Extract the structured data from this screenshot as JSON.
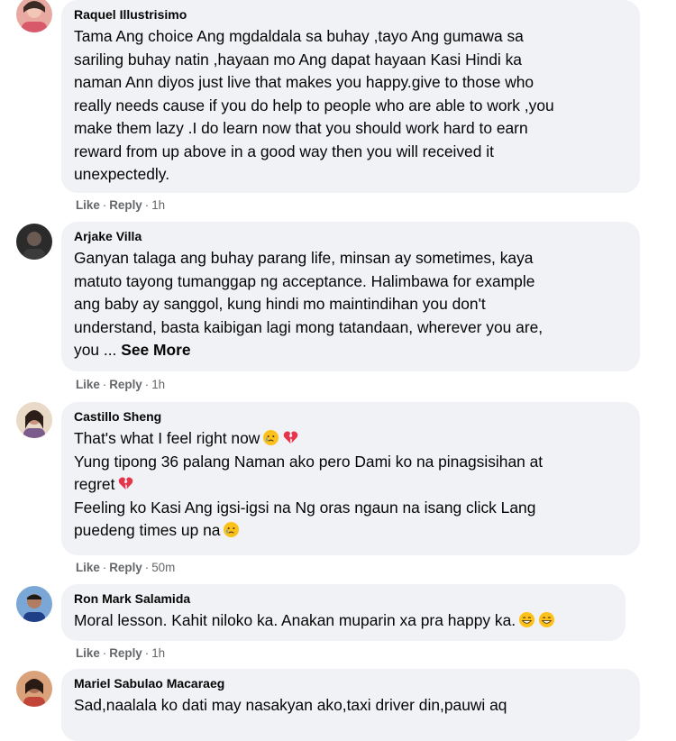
{
  "comments": [
    {
      "author": "Raquel Illustrisimo",
      "lines": [
        "Tama Ang choice Ang mgdaldala sa buhay ,tayo Ang gumawa sa",
        "sariling buhay natin ,hayaan mo Ang dapat hayaan Kasi Hindi ka",
        "naman Ann diyos just live that makes you happy.give to those who",
        "really needs cause if you do help to people who are able to work ,you",
        "make them lazy .I do learn now that you should work hard to earn",
        "reward from up above in a good way then you will received it",
        "unexpectedly."
      ],
      "like_label": "Like",
      "reply_label": "Reply",
      "separator": "·",
      "time": "1h"
    },
    {
      "author": "Arjake Villa",
      "lines": [
        "Ganyan talaga ang buhay parang life, minsan ay sometimes, kaya",
        "matuto tayong tumanggap ng acceptance. Halimbawa for example",
        "ang baby ay sanggol, kung hindi mo maintindihan you don't",
        "understand, basta kaibigan lagi mong tatandaan, wherever you are,",
        "you ..."
      ],
      "see_more": "See More",
      "like_label": "Like",
      "reply_label": "Reply",
      "separator": "·",
      "time": "1h"
    },
    {
      "author": "Castillo Sheng",
      "lines": [
        "That's what I feel right now",
        "Yung tipong 36 palang Naman ako pero Dami ko na pinagsisihan at",
        "regret",
        "Feeling ko Kasi Ang igsi-igsi na Ng oras ngaun na isang click Lang",
        "puedeng times up na"
      ],
      "like_label": "Like",
      "reply_label": "Reply",
      "separator": "·",
      "time": "50m"
    },
    {
      "author": "Ron Mark Salamida",
      "lines": [
        "Moral lesson. Kahit niloko ka. Anakan muparin xa pra happy ka."
      ],
      "like_label": "Like",
      "reply_label": "Reply",
      "separator": "·",
      "time": "1h"
    },
    {
      "author": "Mariel Sabulao Macaraeg",
      "lines": [
        "Sad,naalala ko dati may nasakyan ako,taxi driver din,pauwi aq"
      ]
    }
  ],
  "colors": {
    "bubble_bg": "#f0f2f5",
    "text": "#050505",
    "meta": "#65676b",
    "broken_heart": "#e8344a",
    "emoji_face": "#fcc21b"
  },
  "icons": [
    "crying-face-emoji",
    "broken-heart-emoji",
    "grinning-face-emoji"
  ]
}
